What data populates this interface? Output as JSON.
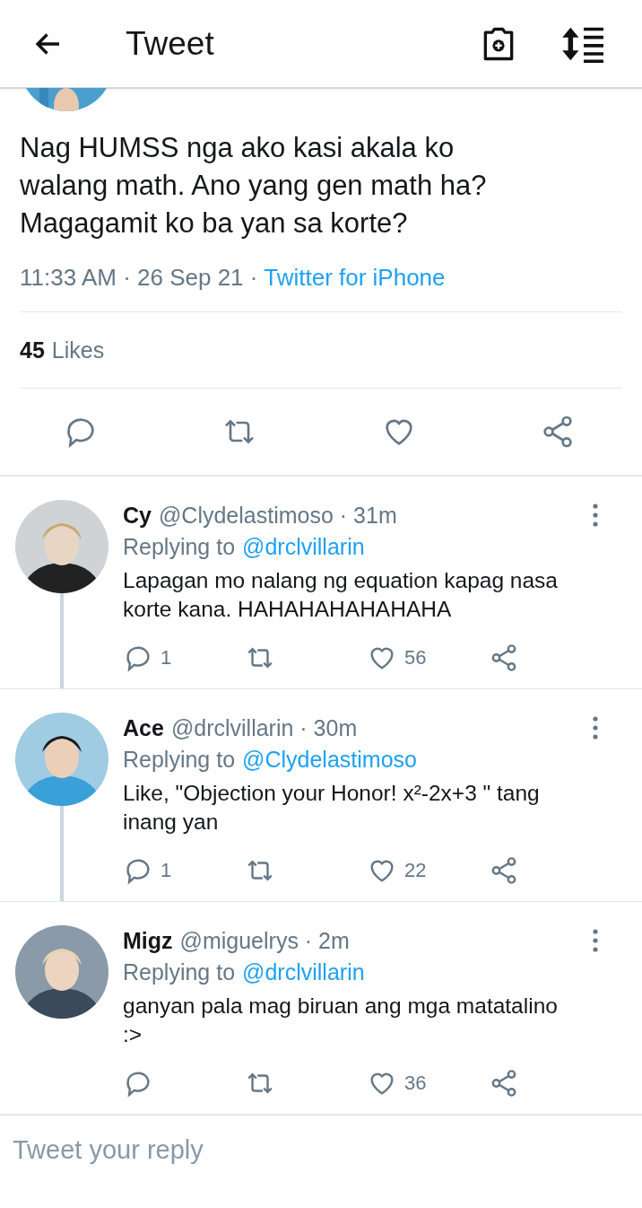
{
  "header": {
    "title": "Tweet"
  },
  "tweet": {
    "text": "Nag HUMSS nga ako kasi akala ko walang math. Ano yang gen math ha? Magagamit ko ba yan sa korte?",
    "time": "11:33 AM · 26 Sep 21 · ",
    "source": "Twitter for iPhone",
    "likes_count": "45",
    "likes_label": "Likes"
  },
  "replies": [
    {
      "name": "Cy",
      "handle": "@Clydelastimoso · 31m",
      "replying_label": "Replying to",
      "replying_to": "@drclvillarin",
      "text": "Lapagan mo nalang ng equation kapag nasa korte kana. HAHAHAHAHAHAHA",
      "replies": "1",
      "likes": "56",
      "thread_line": true
    },
    {
      "name": "Ace",
      "handle": "@drclvillarin · 30m",
      "replying_label": "Replying to",
      "replying_to": "@Clydelastimoso",
      "text": "Like, \"Objection your Honor! x²-2x+3 \" tang inang yan",
      "replies": "1",
      "likes": "22",
      "thread_line": true
    },
    {
      "name": "Migz",
      "handle": "@miguelrys · 2m",
      "replying_label": "Replying to",
      "replying_to": "@drclvillarin",
      "text": "ganyan pala mag biruan ang mga matatalino :>",
      "likes": "36",
      "thread_line": false
    }
  ],
  "reply_bar": {
    "placeholder": "Tweet your reply"
  }
}
